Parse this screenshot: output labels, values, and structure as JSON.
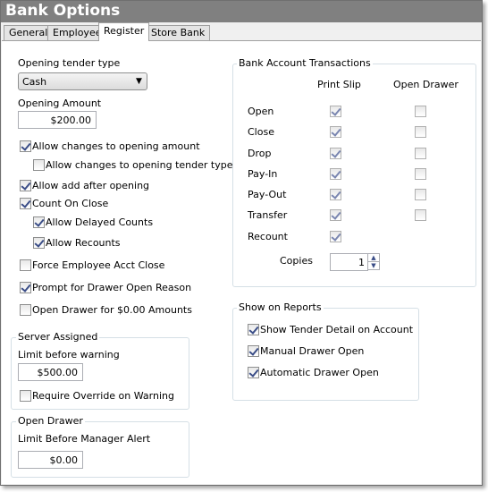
{
  "title": "Bank Options",
  "tabs": [
    {
      "label": "General"
    },
    {
      "label": "Employee"
    },
    {
      "label": "Register"
    },
    {
      "label": "Store Bank"
    }
  ],
  "left": {
    "tender_label": "Opening tender type",
    "tender_value": "Cash",
    "amount_label": "Opening Amount",
    "amount_value": "$200.00",
    "checks": [
      {
        "label": "Allow changes to opening amount",
        "checked": true
      },
      {
        "label": "Allow changes to opening tender type",
        "checked": false
      },
      {
        "label": "Allow add after opening",
        "checked": true
      },
      {
        "label": "Count On Close",
        "checked": true
      },
      {
        "label": "Allow Delayed Counts",
        "checked": true
      },
      {
        "label": "Allow Recounts",
        "checked": true
      },
      {
        "label": "Force Employee Acct Close",
        "checked": false
      },
      {
        "label": "Prompt for Drawer Open Reason",
        "checked": true
      },
      {
        "label": "Open Drawer for $0.00 Amounts",
        "checked": false
      }
    ]
  },
  "server": {
    "title": "Server Assigned",
    "limit_label": "Limit before warning",
    "limit_value": "$500.00",
    "override_label": "Require Override on Warning",
    "override_checked": false
  },
  "open_drawer": {
    "title": "Open Drawer",
    "limit_label": "Limit Before Manager Alert",
    "limit_value": "$0.00"
  },
  "bank": {
    "title": "Bank Account Transactions",
    "col_print": "Print Slip",
    "col_drawer": "Open Drawer",
    "rows": [
      {
        "label": "Open",
        "print": true,
        "drawer": false
      },
      {
        "label": "Close",
        "print": true,
        "drawer": false
      },
      {
        "label": "Drop",
        "print": true,
        "drawer": false
      },
      {
        "label": "Pay-In",
        "print": true,
        "drawer": false
      },
      {
        "label": "Pay-Out",
        "print": true,
        "drawer": false
      },
      {
        "label": "Transfer",
        "print": true,
        "drawer": false
      },
      {
        "label": "Recount",
        "print": true,
        "drawer": null
      }
    ],
    "copies_label": "Copies",
    "copies_value": "1"
  },
  "reports": {
    "title": "Show on Reports",
    "checks": [
      {
        "label": "Show Tender Detail on Account",
        "checked": true
      },
      {
        "label": "Manual Drawer Open",
        "checked": true
      },
      {
        "label": "Automatic Drawer Open",
        "checked": true
      }
    ]
  }
}
